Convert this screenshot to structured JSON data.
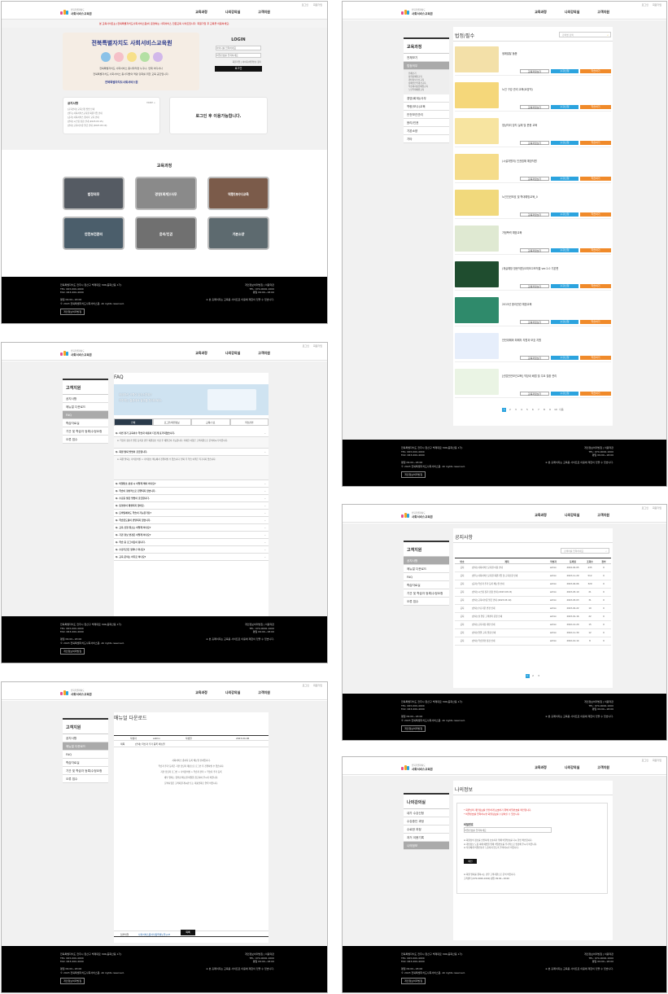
{
  "site": {
    "logo_line1": "전북특별자치도",
    "logo_line2": "사회서비스교육원",
    "util_links": [
      "로그인",
      "회원가입"
    ],
    "gnb": [
      "교육과정",
      "나의강의실",
      "고객지원"
    ]
  },
  "footer": {
    "left_lines": [
      "전북특별자치도 전주시 완산구 백제대로 306(중화산동 1가)",
      "TEL: 063-000-4000",
      "FAX: 063-000-4000",
      "",
      "평일 09:00~18:00",
      "© 2023 전북특별자치도사회서비스원. All rights reserved."
    ],
    "right_lines": [
      "개인정보처리방침 | 이용약관",
      "TEL: 070-0000-1000",
      "평일 09:00~18:00",
      "",
      "※ 본 홈페이지는 교육용 사이트로 이용에 제한이 있을 수 있습니다."
    ],
    "privacy_btn": "개인정보처리방침"
  },
  "home": {
    "notice_bar": "본 교육사이트는 [전북특별자치도사회서비스원]이 운영하는 사회서비스 전문교육 사이트입니다. 회원가입 후 교육을 이용하세요.",
    "hero_title": "전북특별자치도 사회서비스교육원",
    "hero_sub1": "전북특별자치도 사회서비스 종사자라면 누구나, 언제 어디서나",
    "hero_sub2": "전북특별자치도 사회서비스 종사자들의 역량 강화를 위한 교육 공간입니다.",
    "hero_org": "전북특별자치도사회서비스원",
    "login_title": "LOGIN",
    "id_ph": "아이디를 입력하세요",
    "pw_ph": "비밀번호를 입력하세요",
    "login_links": "회원가입 | 아이디/비밀번호 찾기",
    "login_btn": "로그인",
    "notice_title": "공지사항",
    "notice_more": "MORE +",
    "notice_items": [
      "[교육안내] 교육신청 방법 안내",
      "[필독] 사회서비스교육원 회원가입 안내",
      "[공지] 사회서비스 종사자 교육 안내",
      "[안내] 시스템 점검 안내 (2023.03.15)",
      "[안내] 교육이수증 발급 안내 (2023.03.10)"
    ],
    "login_msg": "로그인 후 이용가능합니다.",
    "course_section_title": "교육과정",
    "course_tiles": [
      "법정의무",
      "경영(회계)/사무",
      "역량(보수)교육",
      "안전보건관리",
      "윤리/인권",
      "기본소양"
    ]
  },
  "faq": {
    "side_title": "고객지원",
    "side_items": [
      "공지사항",
      "매뉴얼 다운로드",
      "FAQ",
      "학습자료실",
      "기관 및 학습자 등록/수정요청",
      "오류 접수"
    ],
    "title": "FAQ",
    "banner_line1": "궁금하신 사항이 있으신가요?",
    "banner_line2": "자주하는 질문에서 답변을 찾아보세요.",
    "tabs": [
      "전체",
      "로그인/회원정보",
      "교육/수료",
      "학습관련"
    ],
    "questions": [
      "Q. 이번 정기 교육이수 학습자 이름이 다르게 표기되었습니다.",
      "Q. 회원 탈퇴 방법이 궁금합니다.",
      "Q. 비밀번호 분실 시 어떻게 해야 하나요?",
      "Q. 학습이 정상적으로 진행되지 않습니다.",
      "Q. 수료증 발급 방법이 궁금합니다.",
      "Q. 동영상이 재생되지 않아요.",
      "Q. 모바일에서도 학습이 가능한가요?",
      "Q. 학습진도율이 반영되지 않습니다.",
      "Q. 교육 신청 취소는 어떻게 하나요?",
      "Q. 기관 정보 변경은 어떻게 하나요?",
      "Q. 학습 중 로그아웃이 됩니다.",
      "Q. 수강기간은 얼마나 되나요?",
      "Q. 교육 문의는 어디로 하나요?"
    ],
    "answer1": "A. 학습자 정보가 잘못 등록된 경우 회원정보 수정 후 재발급이 가능합니다. 자세한 사항은 고객지원으로 문의하시기 바랍니다.",
    "answer2": "A. 회원 탈퇴는 나의강의실 > 나의정보 메뉴에서 진행하실 수 있습니다. 탈퇴 후 학습 이력은 복구되지 않습니다."
  },
  "manual": {
    "side_title": "고객지원",
    "side_items": [
      "공지사항",
      "매뉴얼 다운로드",
      "FAQ",
      "학습자료실",
      "기관 및 학습자 등록/수정요청",
      "오류 접수"
    ],
    "title": "매뉴얼 다운로드",
    "meta_label1": "작성자",
    "meta_value1": "admin",
    "meta_label2": "작성일",
    "meta_value2": "2023-04-06",
    "row_label": "제목",
    "row_value": "[안내] 학습자 추가 등록 매뉴얼",
    "body_lines": [
      "사회서비스 종사자 등록 매뉴얼 안내입니다.",
      "학습자 추가 등록은 기관 담당자 계정으로 로그인 후 진행하실 수 있습니다.",
      "기관 담당자 로그인 > 나의강의실 > 학습자 관리 > 학습자 추가 등록",
      "세부 절차는 첨부된 매뉴얼 파일을 참고하여 주시기 바랍니다.",
      "문의사항은 고객지원 게시판 또는 대표전화로 연락 바랍니다."
    ],
    "attach_label": "첨부파일",
    "attach_file": "사회서비스종사자등록매뉴얼.pdf",
    "list_btn": "목록"
  },
  "courses": {
    "side_title": "교육과정",
    "side_items": [
      "전체보기",
      "법정의무",
      "경영(회계)/사무",
      "역량(보수)교육",
      "안전보건관리",
      "윤리/인권",
      "기본소양",
      "기타"
    ],
    "sub_items": [
      "전체보기",
      "성희롱예방교육",
      "개인정보보호교육",
      "장애인인식개선교육",
      "직장내괴롭힘예방교육",
      "노인학대예방교육"
    ],
    "title": "법정/필수",
    "search_ph": "강좌명 검색",
    "items": [
      {
        "name": "생애발달 돌봄",
        "thumb": "#f3e0a8"
      },
      {
        "name": "노인 구강 관리 교육(요양직)",
        "thumb": "#f5d77a"
      },
      {
        "name": "영상처리 장치 실제 및 운용 교육",
        "thumb": "#f7e4a0"
      },
      {
        "name": "(시설자원의) 인권침해 예방직원",
        "thumb": "#f5dc8a"
      },
      {
        "name": "노인인권보호 및 학대예방교육_0",
        "thumb": "#f1d97c"
      },
      {
        "name": "가정폭력 예방교육",
        "thumb": "#dfe9d2"
      },
      {
        "name": "(재실예방 방문직원)오피보고조직결 ver.2.0 기본편",
        "thumb": "#1f4d2f"
      },
      {
        "name": "2015년 윤리관련 예방교육",
        "thumb": "#2f8a6b"
      },
      {
        "name": "안전위해와 피해자 지원과 보호 지원",
        "thumb": "#e6eefb"
      },
      {
        "name": "[산업안전보건교육] 직장내 배법 및 주요 질환 관리",
        "thumb": "#eaf4e4"
      }
    ],
    "btn_detail": "교육과정보기",
    "btn_apply": "수강신청",
    "btn_enter": "학습하기",
    "pages": [
      "1",
      "2",
      "3",
      "4",
      "5",
      "6",
      "7",
      "8",
      "9",
      "10",
      "다음"
    ]
  },
  "notice": {
    "side_title": "고객지원",
    "side_items": [
      "공지사항",
      "매뉴얼 다운로드",
      "FAQ",
      "학습자료실",
      "기관 및 학습자 등록/수정요청",
      "오류 접수"
    ],
    "title": "공지사항",
    "search_ph": "검색어를 입력하세요",
    "columns": [
      "번호",
      "제목",
      "작성자",
      "등록일",
      "조회수",
      "첨부"
    ],
    "rows": [
      [
        "공지",
        "[안내] 사회서비스교육원 이용 안내",
        "admin",
        "2024-02-05",
        "435",
        "0"
      ],
      [
        "공지",
        "[필독] 사회서비스교육원 회원가입 및 교육신청 안내",
        "admin",
        "2023-11-29",
        "512",
        "0"
      ],
      [
        "공지",
        "[공지] 학습자 추가 등록 매뉴얼 안내",
        "admin",
        "2023-04-06",
        "329",
        "0"
      ],
      [
        "공지",
        "[안내] 시스템 정기 점검 안내 (2023.03.15)",
        "admin",
        "2023-03-10",
        "21",
        "0"
      ],
      [
        "공지",
        "[안내] 교육이수증 발급 안내 (2023.03.10)",
        "admin",
        "2023-03-03",
        "31",
        "0"
      ],
      [
        "공지",
        "[안내] 수료기준 변경 안내",
        "admin",
        "2023-02-22",
        "19",
        "0"
      ],
      [
        "공지",
        "[안내] 설 연휴 고객센터 운영 안내",
        "admin",
        "2023-01-16",
        "22",
        "0"
      ],
      [
        "공지",
        "[안내] 교육과정 개편 안내",
        "admin",
        "2022-12-20",
        "15",
        "0"
      ],
      [
        "공지",
        "[안내] 연말 교육 일정 안내",
        "admin",
        "2022-11-30",
        "12",
        "0"
      ],
      [
        "공지",
        "[안내] 학습환경 점검 안내",
        "admin",
        "2022-10-14",
        "8",
        "0"
      ]
    ],
    "pages": [
      "1",
      "2",
      "3"
    ]
  },
  "my": {
    "side_title": "나의강의실",
    "side_items": [
      "내가 수강신청",
      "수강중인 과정",
      "수료한 과정",
      "과거 이용기록",
      "나의정보"
    ],
    "title": "나의정보",
    "warn1": "* 회원님의 개인정보를 안전하게 보호하기 위해 비밀번호를 확인합니다.",
    "warn2": "* 비밀번호를 입력하시면 회원정보를 수정하실 수 있습니다.",
    "pw_label": "비밀번호",
    "pw_ph": "비밀번호를 입력하세요",
    "info_lines": [
      "※ 회원님의 정보를 안전하게 보호하기 위해 비밀번호를 다시 한번 확인합니다.",
      "※ 개인정보 도용 피해 예방을 위해 비밀번호를 주기적으로 변경해 주시기 바랍니다.",
      "※ 타인에게 비밀번호가 노출되지 않도록 주의하시기 바랍니다."
    ],
    "confirm_btn": "확인",
    "info2_lines": [
      "※ 회원 탈퇴를 원하시는 경우 고객지원으로 문의 바랍니다.",
      "고객센터 (070-0000-1000) 평일 09:00~18:00"
    ]
  }
}
